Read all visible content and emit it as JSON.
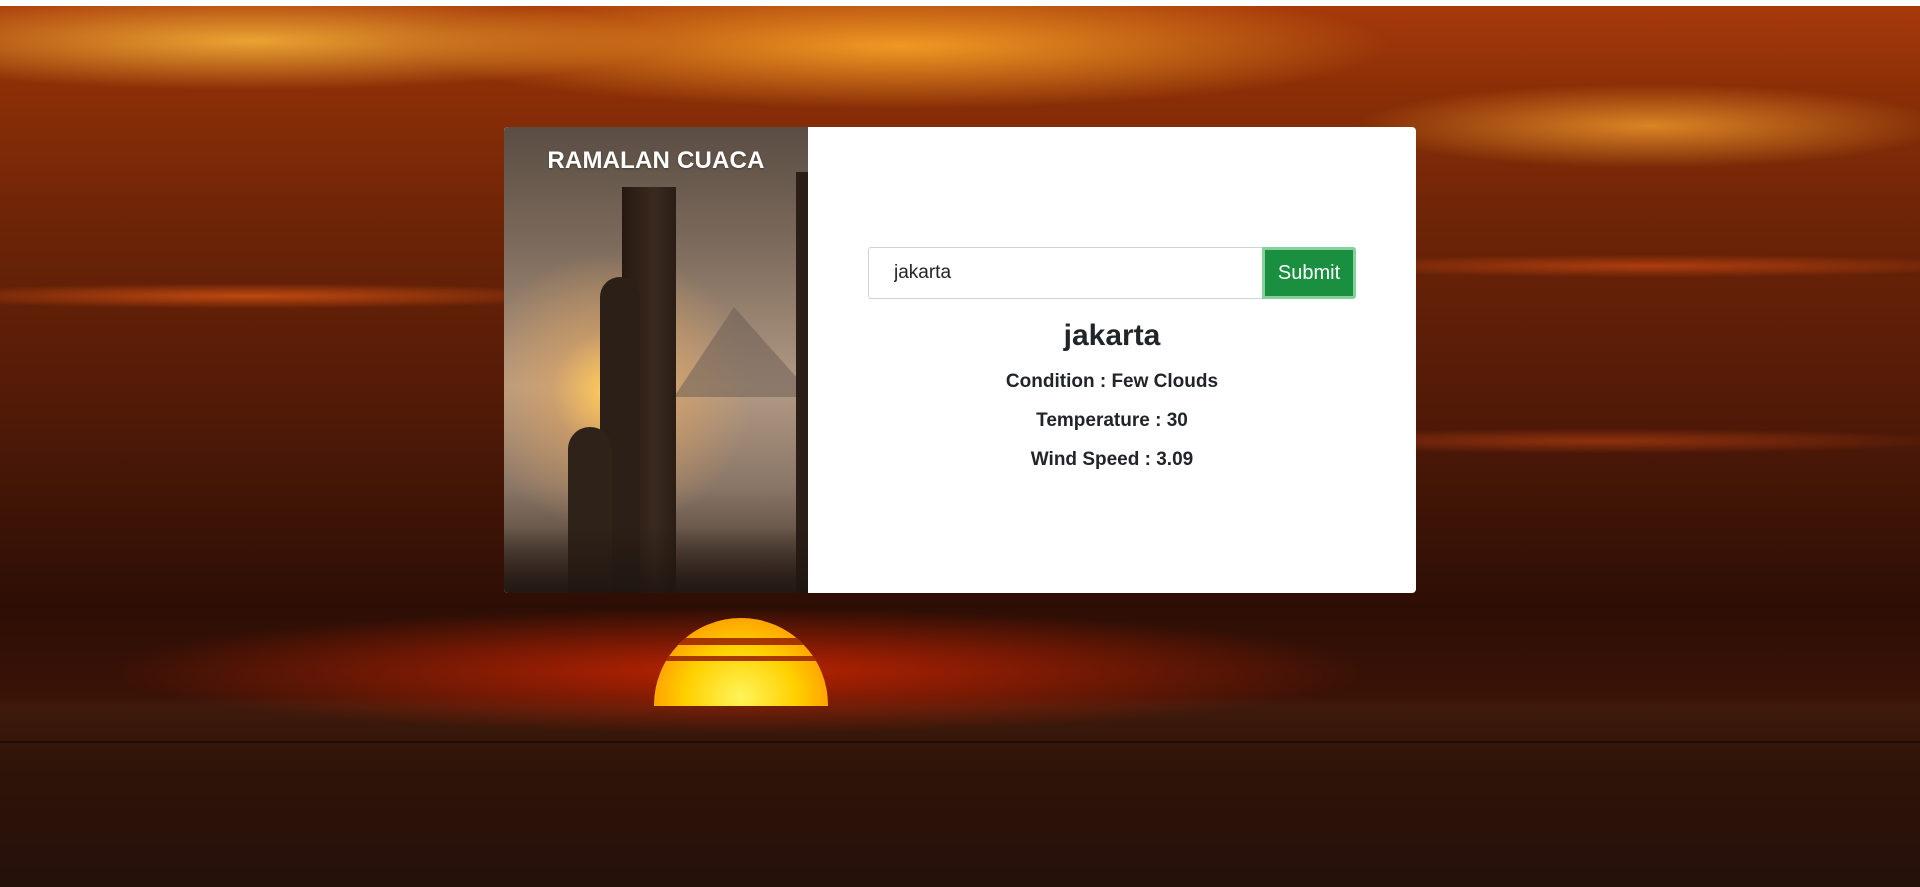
{
  "app": {
    "title": "RAMALAN CUACA"
  },
  "search": {
    "value": "jakarta",
    "submit_label": "Submit"
  },
  "result": {
    "city": "jakarta",
    "condition": "Condition : Few Clouds",
    "temperature": "Temperature : 30",
    "wind_speed": "Wind Speed : 3.09"
  },
  "colors": {
    "submit_button": "#198f3f",
    "submit_border": "#86d09a",
    "card_background": "#ffffff",
    "text": "#212529"
  },
  "icons": {
    "background": "sunset-sea-image",
    "card_image": "temple-gate-sunset-image"
  }
}
